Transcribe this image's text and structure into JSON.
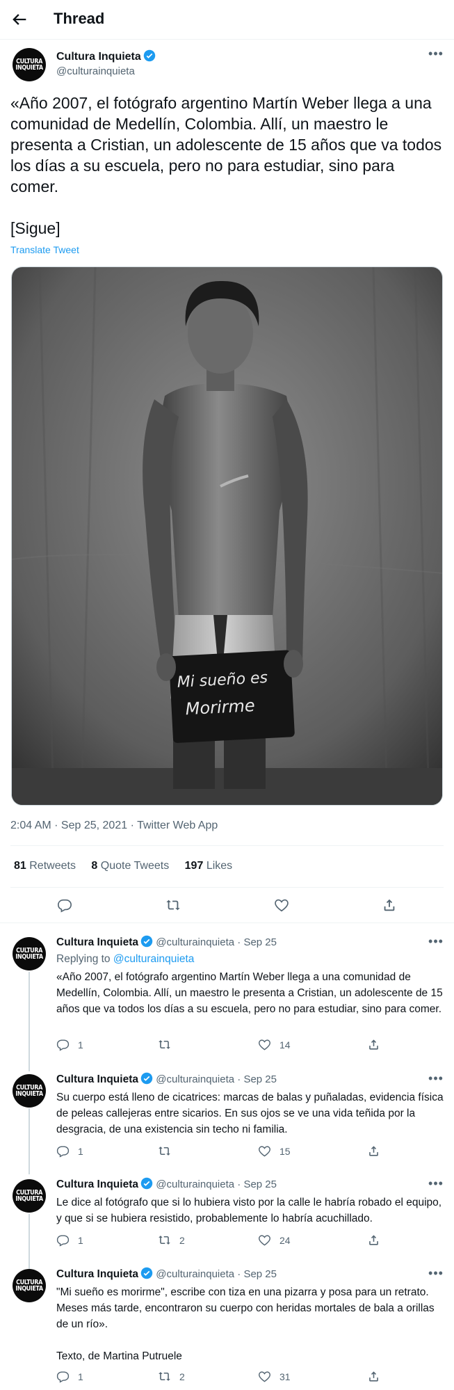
{
  "header": {
    "title": "Thread"
  },
  "author": {
    "name": "Cultura Inquieta",
    "handle": "@culturainquieta",
    "avatar_text": "CULTURA INQUIETA"
  },
  "main_tweet": {
    "text": "«Año 2007, el fotógrafo argentino Martín Weber llega a una comunidad de Medellín, Colombia. Allí, un maestro le presenta a Cristian, un adolescente de 15 años que va todos los días a su escuela, pero no para estudiar, sino para comer.\n\n[Sigue]",
    "translate_label": "Translate Tweet",
    "image_chalkboard_text": "Mi sueño es Morirme",
    "time": "2:04 AM",
    "date": "Sep 25, 2021",
    "source": "Twitter Web App",
    "retweets": "81",
    "retweets_label": "Retweets",
    "quotes": "8",
    "quotes_label": "Quote Tweets",
    "likes": "197",
    "likes_label": "Likes"
  },
  "replies": [
    {
      "date": "Sep 25",
      "replying_prefix": "Replying to",
      "replying_to": "@culturainquieta",
      "text": "«Año 2007, el fotógrafo argentino Martín Weber llega a una comunidad de Medellín, Colombia. Allí, un maestro le presenta a Cristian, un adolescente de 15 años que va todos los días a su escuela, pero no para estudiar, sino para comer.",
      "replies": "1",
      "retweets": "",
      "likes": "14"
    },
    {
      "date": "Sep 25",
      "text": "Su cuerpo está lleno de cicatrices: marcas de balas y puñaladas, evidencia física de peleas callejeras entre sicarios. En sus ojos se ve una vida teñida por la desgracia, de una existencia sin techo ni familia.",
      "replies": "1",
      "retweets": "",
      "likes": "15"
    },
    {
      "date": "Sep 25",
      "text": "Le dice al fotógrafo que si lo hubiera visto por la calle le habría robado el equipo, y que si se hubiera resistido, probablemente lo habría acuchillado.",
      "replies": "1",
      "retweets": "2",
      "likes": "24"
    },
    {
      "date": "Sep 25",
      "text": "\"Mi sueño es morirme\", escribe con tiza en una pizarra y posa para un retrato. Meses más tarde, encontraron su cuerpo con heridas mortales de bala a orillas de un río».\n\nTexto, de Martina Putruele",
      "replies": "1",
      "retweets": "2",
      "likes": "31"
    }
  ],
  "colors": {
    "link": "#1d9bf0",
    "muted": "#536471",
    "text": "#0f1419",
    "border": "#eff3f4"
  }
}
